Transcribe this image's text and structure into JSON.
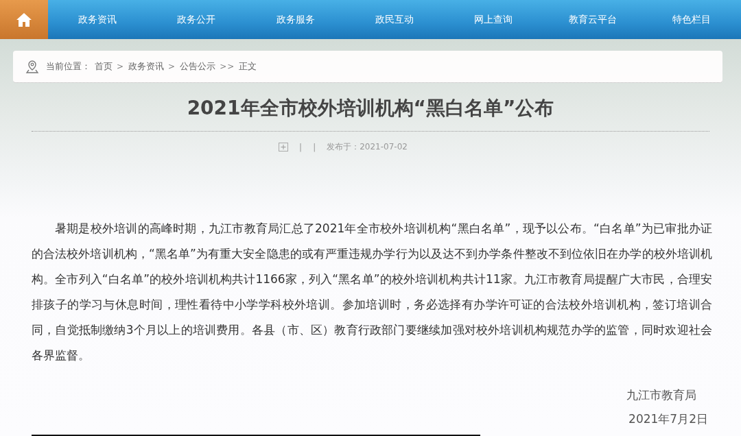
{
  "nav": {
    "items": [
      {
        "label": "政务资讯"
      },
      {
        "label": "政务公开"
      },
      {
        "label": "政务服务"
      },
      {
        "label": "政民互动"
      },
      {
        "label": "网上查询"
      },
      {
        "label": "教育云平台"
      },
      {
        "label": "特色栏目"
      }
    ]
  },
  "breadcrumb": {
    "prefix": "当前位置：",
    "items": [
      {
        "kind": "link",
        "text": "首页"
      },
      {
        "kind": "separator",
        "text": ">"
      },
      {
        "kind": "link",
        "text": "政务资讯"
      },
      {
        "kind": "separator",
        "text": ">"
      },
      {
        "kind": "link",
        "text": "公告公示"
      },
      {
        "kind": "separator",
        "text": ">>"
      },
      {
        "kind": "link",
        "text": "正文"
      }
    ]
  },
  "article": {
    "title": "2021年全市校外培训机构“黑白名单”公布",
    "meta": [
      "|",
      "|",
      "发布于：2021-07-02"
    ],
    "body": "暑期是校外培训的高峰时期，九江市教育局汇总了2021年全市校外培训机构“黑白名单”，现予以公布。“白名单”为已审批办证的合法校外培训机构，“黑名单”为有重大安全隐患的或有严重违规办学行为以及达不到办学条件整改不到位依旧在办学的校外培训机构。全市列入“白名单”的校外培训机构共计1166家，列入“黑名单”的校外培训机构共计11家。九江市教育局提醒广大市民，合理安排孩子的学习与休息时间，理性看待中小学学科校外培训。参加培训时，务必选择有办学许可证的合法校外培训机构，签订培训合同，自觉抵制缴纳3个月以上的培训费用。各县（市、区）教育行政部门要继续加强对校外培训机构规范办学的监管，同时欢迎社会各界监督。",
    "signature": "九江市教育局",
    "date": "2021年7月2日"
  }
}
